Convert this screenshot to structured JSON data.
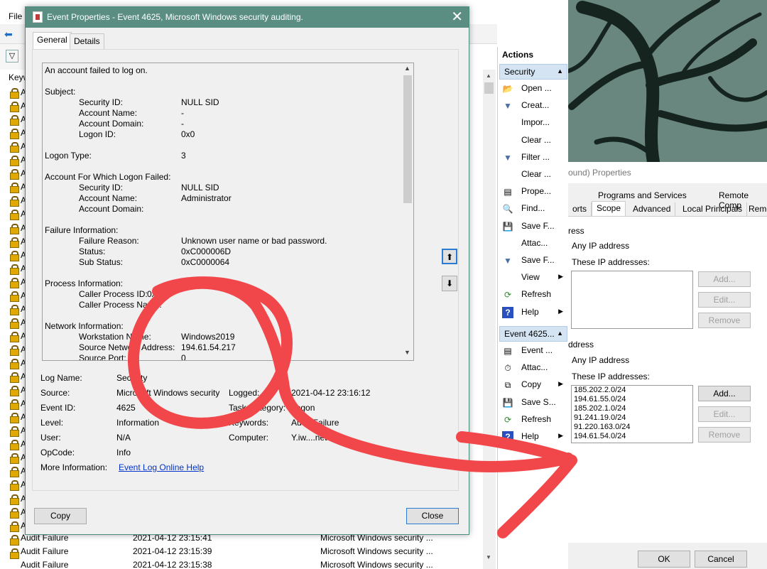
{
  "background": {
    "menu": {
      "file": "File"
    },
    "list_header": "Keyw",
    "rows": [
      {
        "keyword": "Audit Failure",
        "date": "2021-04-12 23:15:41",
        "source": "Microsoft Windows security ..."
      },
      {
        "keyword": "Audit Failure",
        "date": "2021-04-12 23:15:39",
        "source": "Microsoft Windows security ..."
      },
      {
        "keyword": "Audit Failure",
        "date": "2021-04-12 23:15:38",
        "source": "Microsoft Windows security ..."
      }
    ],
    "lock_letter": "A"
  },
  "actions": {
    "title": "Actions",
    "section1": "Security",
    "items1": [
      {
        "label": "Open ...",
        "icon": "folder-open-icon",
        "glyph": "📂"
      },
      {
        "label": "Creat...",
        "icon": "filter-icon",
        "glyph": "▼"
      },
      {
        "label": "Impor...",
        "icon": "",
        "glyph": ""
      },
      {
        "label": "Clear ...",
        "icon": "",
        "glyph": ""
      },
      {
        "label": "Filter ...",
        "icon": "filter-icon",
        "glyph": "▼"
      },
      {
        "label": "Clear ...",
        "icon": "",
        "glyph": ""
      },
      {
        "label": "Prope...",
        "icon": "properties-icon",
        "glyph": "▤"
      },
      {
        "label": "Find...",
        "icon": "binoculars-icon",
        "glyph": "🔍"
      },
      {
        "label": "Save F...",
        "icon": "save-icon",
        "glyph": "💾"
      },
      {
        "label": "Attac...",
        "icon": "",
        "glyph": ""
      },
      {
        "label": "Save F...",
        "icon": "filter-save-icon",
        "glyph": "▼"
      },
      {
        "label": "View",
        "icon": "",
        "glyph": "",
        "submenu": true
      },
      {
        "label": "Refresh",
        "icon": "refresh-icon",
        "glyph": "⟳"
      },
      {
        "label": "Help",
        "icon": "help-icon",
        "glyph": "?",
        "submenu": true
      }
    ],
    "section2": "Event 4625...",
    "items2": [
      {
        "label": "Event ...",
        "icon": "event-properties-icon",
        "glyph": "▤"
      },
      {
        "label": "Attac...",
        "icon": "attach-task-icon",
        "glyph": "⏱"
      },
      {
        "label": "Copy",
        "icon": "copy-icon",
        "glyph": "⧉",
        "submenu": true
      },
      {
        "label": "Save S...",
        "icon": "save-icon",
        "glyph": "💾"
      },
      {
        "label": "Refresh",
        "icon": "refresh-icon",
        "glyph": "⟳"
      },
      {
        "label": "Help",
        "icon": "help-icon",
        "glyph": "?",
        "submenu": true
      }
    ]
  },
  "firewall": {
    "title": "ound) Properties",
    "tabs_top": [
      "Programs and Services",
      "Remote Comp"
    ],
    "tabs": [
      "orts",
      "Scope",
      "Advanced",
      "Local Principals",
      "Remo"
    ],
    "local": {
      "group_label": "ress",
      "any_ip": "Any IP address",
      "these_ip": "These IP addresses:",
      "ips": [],
      "buttons": [
        "Add...",
        "Edit...",
        "Remove"
      ]
    },
    "remote": {
      "group_label": "ddress",
      "any_ip": "Any IP address",
      "these_ip": "These IP addresses:",
      "ips": [
        "185.202.2.0/24",
        "194.61.55.0/24",
        "185.202.1.0/24",
        "91.241.19.0/24",
        "91.220.163.0/24",
        "194.61.54.0/24"
      ],
      "buttons": [
        "Add...",
        "Edit...",
        "Remove"
      ]
    },
    "bottom_buttons": [
      "OK",
      "Cancel"
    ]
  },
  "dialog": {
    "title": "Event Properties - Event 4625, Microsoft Windows security auditing.",
    "close_glyph": "✕",
    "tabs": [
      "General",
      "Details"
    ],
    "description": {
      "intro": "An account failed to log on.",
      "subject_h": "Subject:",
      "subject": [
        {
          "k": "Security ID:",
          "v": "NULL SID"
        },
        {
          "k": "Account Name:",
          "v": "-"
        },
        {
          "k": "Account Domain:",
          "v": "-"
        },
        {
          "k": "Logon ID:",
          "v": "0x0"
        }
      ],
      "logon_type_k": "Logon Type:",
      "logon_type_v": "3",
      "failed_h": "Account For Which Logon Failed:",
      "failed": [
        {
          "k": "Security ID:",
          "v": "NULL SID"
        },
        {
          "k": "Account Name:",
          "v": "Administrator"
        },
        {
          "k": "Account Domain:",
          "v": ""
        }
      ],
      "failure_h": "Failure Information:",
      "failure": [
        {
          "k": "Failure Reason:",
          "v": "Unknown user name or bad password."
        },
        {
          "k": "Status:",
          "v": "0xC000006D"
        },
        {
          "k": "Sub Status:",
          "v": "0xC0000064"
        }
      ],
      "process_h": "Process Information:",
      "process": [
        {
          "k": "Caller Process ID:",
          "v": "0x0"
        },
        {
          "k": "Caller Process Name:",
          "v": ""
        }
      ],
      "network_h": "Network Information:",
      "network": [
        {
          "k": "Workstation Name:",
          "v": "Windows2019"
        },
        {
          "k": "Source Network Address:",
          "v": "194.61.54.217"
        },
        {
          "k": "Source Port:",
          "v": "0"
        }
      ]
    },
    "meta": {
      "log_name_k": "Log Name:",
      "log_name_v": "Security",
      "source_k": "Source:",
      "source_v": "Microsoft Windows security",
      "logged_k": "Logged:",
      "logged_v": "2021-04-12 23:16:12",
      "event_id_k": "Event ID:",
      "event_id_v": "4625",
      "task_k": "Task Category:",
      "task_v": "Logon",
      "level_k": "Level:",
      "level_v": "Information",
      "keywords_k": "Keywords:",
      "keywords_v": "Audit Failure",
      "user_k": "User:",
      "user_v": "N/A",
      "computer_k": "Computer:",
      "computer_v": "Y.iw....net",
      "opcode_k": "OpCode:",
      "opcode_v": "Info",
      "more_k": "More Information:",
      "more_link": "Event Log Online Help"
    },
    "copy_button": "Copy",
    "close_button": "Close"
  },
  "annotation": {
    "color": "#f2474a"
  }
}
